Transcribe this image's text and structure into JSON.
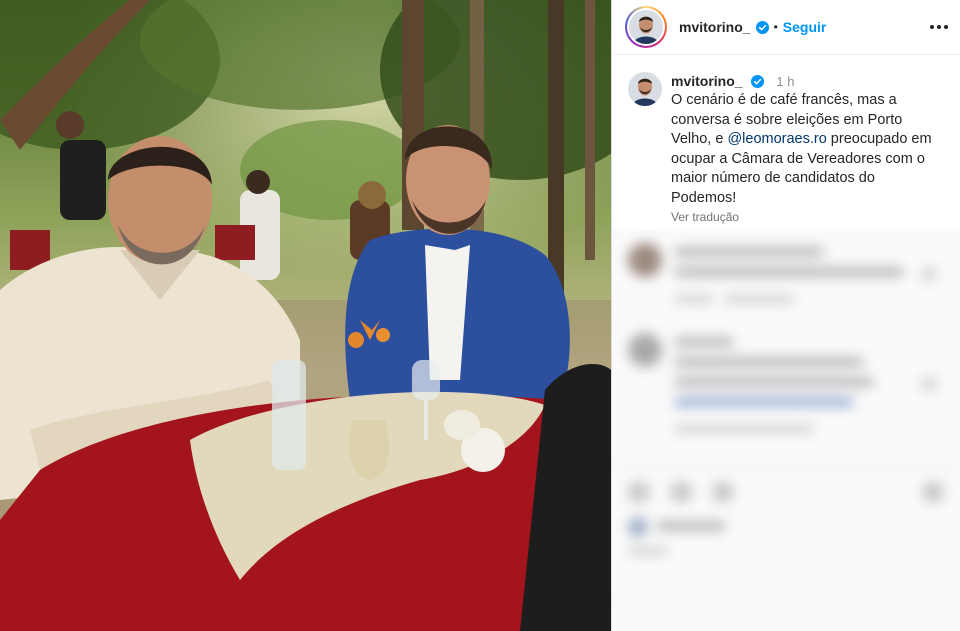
{
  "photo": {
    "description_icon": "photo-icon"
  },
  "header": {
    "username": "mvitorino_",
    "separator": "•",
    "follow_label": "Seguir",
    "more_icon": "more-horizontal-icon",
    "verified_icon": "verified-badge-icon"
  },
  "caption": {
    "username": "mvitorino_",
    "time": "1 h",
    "text_part1": "O cenário é de café francês, mas a conversa é sobre eleições em Porto Velho, e ",
    "mention": "@leomoraes.ro",
    "text_part2": " preocupado em ocupar a Câmara de Vereadores com o maior número de candidatos do Podemos!",
    "translate_label": "Ver tradução"
  },
  "colors": {
    "accent": "#0095f6",
    "text": "#262626",
    "muted": "#737373",
    "mention": "#00376b",
    "tablecloth": "#a3141c"
  }
}
